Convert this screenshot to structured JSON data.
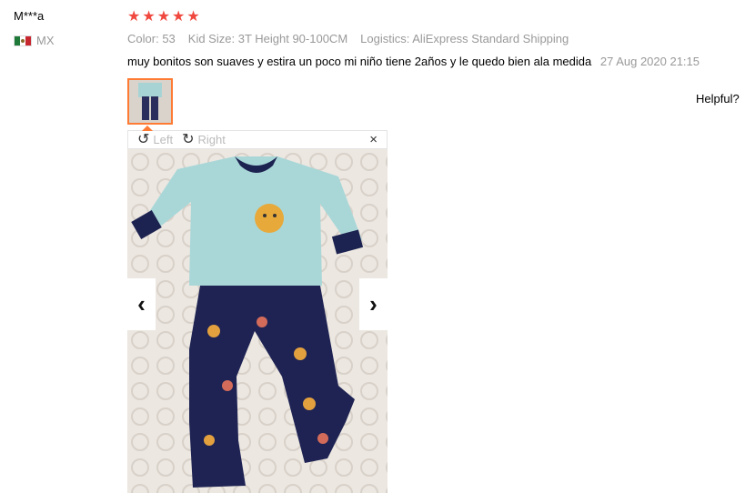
{
  "review": {
    "user_name": "M***a",
    "country_code": "MX",
    "rating": 5,
    "stars": [
      "★",
      "★",
      "★",
      "★",
      "★"
    ],
    "meta": [
      {
        "key": "Color:",
        "value": "53"
      },
      {
        "key": "Kid Size:",
        "value": "3T Height 90-100CM"
      },
      {
        "key": "Logistics:",
        "value": "AliExpress Standard Shipping"
      }
    ],
    "text": "muy bonitos son suaves y estira un poco mi niño tiene 2años y le quedo bien ala medida",
    "date": "27 Aug 2020 21:15",
    "helpful_label": "Helpful?"
  },
  "viewer": {
    "rotate_left_label": "Left",
    "rotate_right_label": "Right",
    "close_glyph": "×",
    "prev_glyph": "‹",
    "next_glyph": "›",
    "rotate_left_glyph": "↺",
    "rotate_right_glyph": "↻"
  },
  "colors": {
    "star": "#f0483e",
    "thumb_border": "#ff7a33",
    "muted_text": "#999999"
  }
}
